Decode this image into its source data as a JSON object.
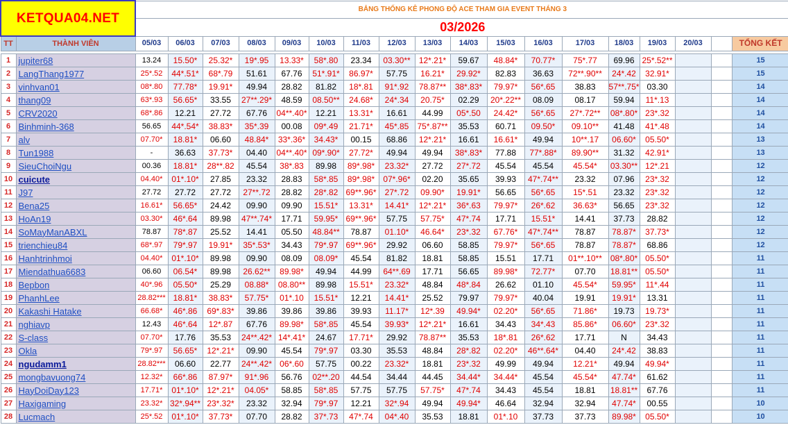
{
  "logo": "KETQUA04.NET",
  "title": "BẢNG THỐNG KÊ PHONG ĐỘ ACE THAM GIA EVENT THÁNG 3",
  "month": "03/2026",
  "headers": {
    "tt": "TT",
    "member": "THÀNH VIÊN",
    "total": "TỔNG KẾT",
    "dates": [
      "05/03",
      "06/03",
      "07/03",
      "08/03",
      "09/03",
      "10/03",
      "11/03",
      "12/03",
      "13/03",
      "14/03",
      "15/03",
      "16/03",
      "17/03",
      "18/03",
      "19/03",
      "20/03"
    ]
  },
  "rows": [
    {
      "tt": "1",
      "name": "jupiter68",
      "cells": [
        "13.24",
        "15.50*",
        "25.32*",
        "19*.95",
        "13.33*",
        "58*.80",
        "23.34",
        "03.30**",
        "12*.21*",
        "59.67",
        "48.84*",
        "70.77*",
        "75*.77",
        "69.96",
        "25*.52**",
        ""
      ],
      "total": "15"
    },
    {
      "tt": "2",
      "name": "LangThang1977",
      "cells": [
        "25*.52",
        "44*.51*",
        "68*.79",
        "51.61",
        "67.76",
        "51*.91*",
        "86.97*",
        "57.75",
        "16.21*",
        "29.92*",
        "82.83",
        "36.63",
        "72**.90**",
        "24*.42",
        "32.91*",
        ""
      ],
      "total": "15"
    },
    {
      "tt": "3",
      "name": "vinhvan01",
      "cells": [
        "08*.80",
        "77.78*",
        "19.91*",
        "49.94",
        "28.82",
        "81.82",
        "18*.81",
        "91*.92",
        "78.87**",
        "38*.83*",
        "79.97*",
        "56*.65",
        "38.83",
        "57**.75*",
        "03.30",
        ""
      ],
      "total": "14"
    },
    {
      "tt": "4",
      "name": "thang09",
      "cells": [
        "63*.93",
        "56.65*",
        "33.55",
        "27**.29*",
        "48.59",
        "08.50**",
        "24.68*",
        "24*.34",
        "20.75*",
        "02.29",
        "20*.22**",
        "08.09",
        "08.17",
        "59.94",
        "11*.13",
        ""
      ],
      "total": "14"
    },
    {
      "tt": "5",
      "name": "CRV2020",
      "cells": [
        "68*.86",
        "12.21",
        "27.72",
        "67.76",
        "04**.40*",
        "12.21",
        "13.31*",
        "16.61",
        "44.99",
        "05*.50",
        "24.42*",
        "56*.65",
        "27*.72**",
        "08*.80*",
        "23*.32",
        ""
      ],
      "total": "14"
    },
    {
      "tt": "6",
      "name": "Binhminh-368",
      "cells": [
        "56.65",
        "44*.54*",
        "38.83*",
        "35*.39",
        "00.08",
        "09*.49",
        "21.71*",
        "45*.85",
        "75*.87**",
        "35.53",
        "60.71",
        "09.50*",
        "09.10**",
        "41.48",
        "41*.48",
        ""
      ],
      "total": "14"
    },
    {
      "tt": "7",
      "name": "alv",
      "cells": [
        "07.70*",
        "18.81*",
        "06.60",
        "48.84*",
        "33*.36*",
        "34.43*",
        "00.15",
        "68.86",
        "12*.21*",
        "16.61",
        "16.61*",
        "49.94",
        "10**.17",
        "06.60*",
        "05.50*",
        ""
      ],
      "total": "13"
    },
    {
      "tt": "8",
      "name": "Tun1988",
      "cells": [
        "-",
        "36.63",
        "37.73*",
        "04.40",
        "04**.40*",
        "09*.90*",
        "27.72*",
        "49.94",
        "49.94",
        "38*.83*",
        "77.88",
        "77*.88*",
        "89.90**",
        "31.32",
        "42.91*",
        ""
      ],
      "total": "13"
    },
    {
      "tt": "9",
      "name": "SieuChoiNgu",
      "cells": [
        "00.36",
        "18.81*",
        "28**.82",
        "45.54",
        "38*.83",
        "89.98",
        "89*.98*",
        "23.32*",
        "27.72",
        "27*.72",
        "45.54",
        "45.54",
        "45.54*",
        "03.30**",
        "12*.21",
        ""
      ],
      "total": "12"
    },
    {
      "tt": "10",
      "name": "cuicute",
      "cells": [
        "04.40*",
        "01*.10*",
        "27.85",
        "23.32",
        "28.83",
        "58*.85",
        "89*.98*",
        "07*.96*",
        "02.20",
        "35.65",
        "39.93",
        "47*.74**",
        "23.32",
        "07.96",
        "23*.32",
        ""
      ],
      "total": "12"
    },
    {
      "tt": "11",
      "name": "J97",
      "cells": [
        "27.72",
        "27.72",
        "27.72",
        "27**.72",
        "28.82",
        "28*.82",
        "69**.96*",
        "27*.72",
        "09.90*",
        "19.91*",
        "56.65",
        "56*.65",
        "15*.51",
        "23.32",
        "23*.32",
        ""
      ],
      "total": "12"
    },
    {
      "tt": "12",
      "name": "Bena25",
      "cells": [
        "16.61*",
        "56.65*",
        "24.42",
        "09.90",
        "09.90",
        "15.51*",
        "13.31*",
        "14.41*",
        "12*.21*",
        "36*.63",
        "79.97*",
        "26*.62",
        "36.63*",
        "56.65",
        "23*.32",
        ""
      ],
      "total": "12"
    },
    {
      "tt": "13",
      "name": "HoAn19",
      "cells": [
        "03.30*",
        "46*.64",
        "89.98",
        "47**.74*",
        "17.71",
        "59.95*",
        "69**.96*",
        "57.75",
        "57.75*",
        "47*.74",
        "17.71",
        "15.51*",
        "14.41",
        "37.73",
        "28.82",
        ""
      ],
      "total": "12"
    },
    {
      "tt": "14",
      "name": "SoMayManABXL",
      "cells": [
        "78.87",
        "78*.87",
        "25.52",
        "14.41",
        "05.50",
        "48.84**",
        "78.87",
        "01.10*",
        "46.64*",
        "23*.32",
        "67.76*",
        "47*.74**",
        "78.87",
        "78.87*",
        "37.73*",
        ""
      ],
      "total": "12"
    },
    {
      "tt": "15",
      "name": "trienchieu84",
      "cells": [
        "68*.97",
        "79*.97",
        "19.91*",
        "35*.53*",
        "34.43",
        "79*.97",
        "69**.96*",
        "29.92",
        "06.60",
        "58.85",
        "79.97*",
        "56*.65",
        "78.87",
        "78.87*",
        "68.86",
        ""
      ],
      "total": "12"
    },
    {
      "tt": "16",
      "name": "Hanhtrinhmoi",
      "cells": [
        "04.40*",
        "01*.10*",
        "89.98",
        "09.90",
        "08.09",
        "08.09*",
        "45.54",
        "81.82",
        "18.81",
        "58.85",
        "15.51",
        "17.71",
        "01**.10**",
        "08*.80*",
        "05.50*",
        ""
      ],
      "total": "11"
    },
    {
      "tt": "17",
      "name": "Miendathua6683",
      "cells": [
        "06.60",
        "06.54*",
        "89.98",
        "26.62**",
        "89.98*",
        "49.94",
        "44.99",
        "64**.69",
        "17.71",
        "56.65",
        "89.98*",
        "72.77*",
        "07.70",
        "18.81**",
        "05.50*",
        ""
      ],
      "total": "11"
    },
    {
      "tt": "18",
      "name": "Bepbon",
      "cells": [
        "40*.96",
        "05.50*",
        "25.29",
        "08.88*",
        "08.80**",
        "89.98",
        "15.51*",
        "23.32*",
        "48.84",
        "48*.84",
        "26.62",
        "01.10",
        "45.54*",
        "59.95*",
        "11*.44",
        ""
      ],
      "total": "11"
    },
    {
      "tt": "19",
      "name": "PhanhLee",
      "cells": [
        "28.82***",
        "18.81*",
        "38.83*",
        "57.75*",
        "01*.10",
        "15.51*",
        "12.21",
        "14.41*",
        "25.52",
        "79.97",
        "79.97*",
        "40.04",
        "19.91",
        "19.91*",
        "13.31",
        ""
      ],
      "total": "11"
    },
    {
      "tt": "20",
      "name": "Kakashi Hatake",
      "cells": [
        "66.68*",
        "46*.86",
        "69*.83*",
        "39.86",
        "39.86",
        "39.86",
        "39.93",
        "11.17*",
        "12*.39",
        "49.94*",
        "02.20*",
        "56*.65",
        "71.86*",
        "19.73",
        "19.73*",
        ""
      ],
      "total": "11"
    },
    {
      "tt": "21",
      "name": "nghiavp",
      "cells": [
        "12.43",
        "46*.64",
        "12*.87",
        "67.76",
        "89.98*",
        "58*.85",
        "45.54",
        "39.93*",
        "12*.21*",
        "16.61",
        "34.43",
        "34*.43",
        "85.86*",
        "06.60*",
        "23*.32",
        ""
      ],
      "total": "11"
    },
    {
      "tt": "22",
      "name": "S-class",
      "cells": [
        "07.70*",
        "17.76",
        "35.53",
        "24**.42*",
        "14*.41*",
        "24.67",
        "17.71*",
        "29.92",
        "78.87**",
        "35.53",
        "18*.81",
        "26*.62",
        "17.71",
        "N",
        "34.43",
        ""
      ],
      "total": "11"
    },
    {
      "tt": "23",
      "name": "Okla",
      "cells": [
        "79*.97",
        "56.65*",
        "12*.21*",
        "09.90",
        "45.54",
        "79*.97",
        "03.30",
        "35.53",
        "48.84",
        "28*.82",
        "02.20*",
        "46**.64*",
        "04.40",
        "24*.42",
        "38.83",
        ""
      ],
      "total": "11"
    },
    {
      "tt": "24",
      "name": "ngudamm1",
      "cells": [
        "28.82***",
        "06.60",
        "22.77",
        "24**.42*",
        "06*.60",
        "57.75",
        "00.22",
        "23.32*",
        "18.81",
        "23*.32",
        "49.99",
        "49.94",
        "12.21*",
        "49.94",
        "49.94*",
        ""
      ],
      "total": "11"
    },
    {
      "tt": "25",
      "name": "mongbavuong74",
      "cells": [
        "12.32*",
        "66*.86",
        "87.97*",
        "91*.96",
        "56.76",
        "02**.20",
        "44.54",
        "34.44",
        "44.45",
        "34.44*",
        "34.44*",
        "45.54",
        "45.54*",
        "47.74*",
        "61.62",
        ""
      ],
      "total": "11"
    },
    {
      "tt": "26",
      "name": "HayDoiDay123",
      "cells": [
        "17.71*",
        "01*.10*",
        "12*.21*",
        "04.05*",
        "58.85",
        "58*.85",
        "57.75",
        "57.75",
        "57.75*",
        "47*.74",
        "34.43",
        "45.54",
        "18.81",
        "18.81**",
        "67.76",
        ""
      ],
      "total": "11"
    },
    {
      "tt": "27",
      "name": "Haxigaming",
      "cells": [
        "23.32*",
        "32*.94**",
        "23*.32*",
        "23.32",
        "32.94",
        "79*.97",
        "12.21",
        "32*.94",
        "49.94",
        "49.94*",
        "46.64",
        "32.94",
        "32.94",
        "47.74*",
        "00.55",
        ""
      ],
      "total": "10"
    },
    {
      "tt": "28",
      "name": "Lucmach",
      "cells": [
        "25*.52",
        "01*.10*",
        "37.73*",
        "07.70",
        "28.82",
        "37*.73",
        "47*.74",
        "04*.40",
        "35.53",
        "18.81",
        "01*.10",
        "37.73",
        "37.73",
        "89.98*",
        "05.50*",
        ""
      ],
      "total": "10"
    }
  ],
  "colors": {
    "red": "#e00000",
    "header_bg": "#b8cfe6",
    "name_bg": "#d6d0e2",
    "total_bg": "#c7dff5",
    "logo_bg": "#ffff00"
  }
}
